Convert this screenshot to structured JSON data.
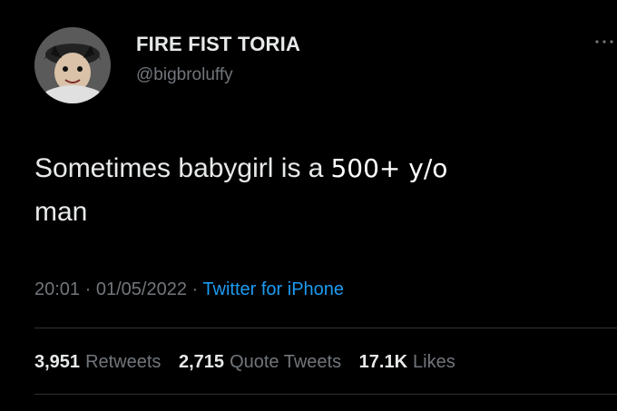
{
  "user": {
    "display_name": "FIRE FIST TORIA",
    "handle": "@bigbroluffy",
    "avatar": "anime-character-avatar"
  },
  "tweet": {
    "text_line1": "Sometimes babygirl is a",
    "text_overlay": "500+ y/o",
    "text_line2": "man",
    "time": "20:01",
    "separator": "·",
    "date": "01/05/2022",
    "source": "Twitter for iPhone"
  },
  "stats": {
    "retweets_count": "3,951",
    "retweets_label": "Retweets",
    "quote_tweets_count": "2,715",
    "quote_tweets_label": "Quote Tweets",
    "likes_count": "17.1K",
    "likes_label": "Likes"
  },
  "icons": {
    "more": "more-options-icon"
  },
  "colors": {
    "background": "#000000",
    "primary_text": "#e7e9ea",
    "secondary_text": "#71767b",
    "link": "#1d9bf0",
    "divider": "#2f3336"
  }
}
